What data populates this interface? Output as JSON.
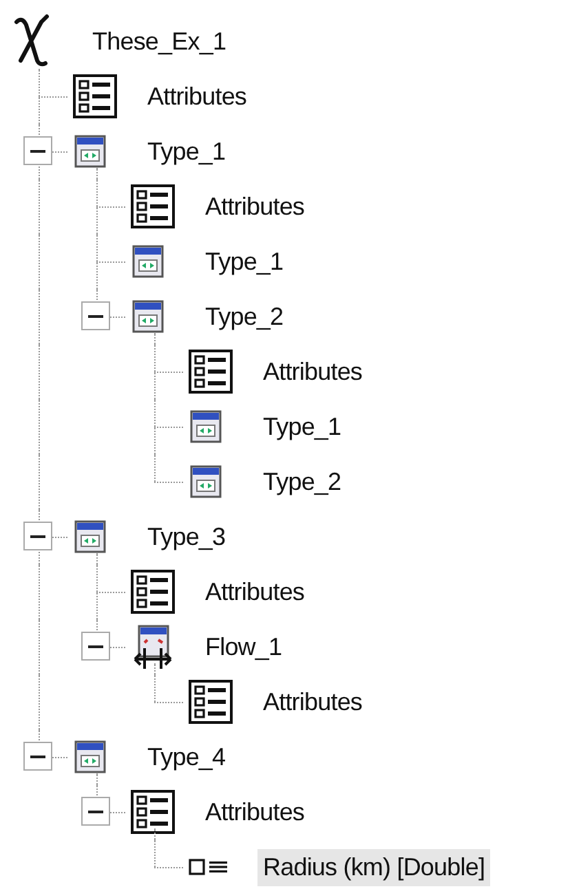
{
  "tree": {
    "label": "These_Ex_1",
    "kind": "root",
    "selected": false,
    "children": [
      {
        "label": "Attributes",
        "kind": "attributes",
        "selected": false
      },
      {
        "label": "Type_1",
        "kind": "type",
        "expanded": true,
        "selected": false,
        "children": [
          {
            "label": "Attributes",
            "kind": "attributes",
            "selected": false
          },
          {
            "label": "Type_1",
            "kind": "type",
            "selected": false
          },
          {
            "label": "Type_2",
            "kind": "type",
            "expanded": true,
            "selected": false,
            "children": [
              {
                "label": "Attributes",
                "kind": "attributes",
                "selected": false
              },
              {
                "label": "Type_1",
                "kind": "type",
                "selected": false
              },
              {
                "label": "Type_2",
                "kind": "type",
                "selected": false
              }
            ]
          }
        ]
      },
      {
        "label": "Type_3",
        "kind": "type",
        "expanded": true,
        "selected": false,
        "children": [
          {
            "label": "Attributes",
            "kind": "attributes",
            "selected": false
          },
          {
            "label": "Flow_1",
            "kind": "flow",
            "expanded": true,
            "selected": false,
            "children": [
              {
                "label": "Attributes",
                "kind": "attributes",
                "selected": false
              }
            ]
          }
        ]
      },
      {
        "label": "Type_4",
        "kind": "type",
        "expanded": true,
        "selected": false,
        "children": [
          {
            "label": "Attributes",
            "kind": "attributes",
            "expanded": true,
            "selected": false,
            "children": [
              {
                "label": "Radius (km) [Double]",
                "kind": "field",
                "selected": true
              }
            ]
          }
        ]
      }
    ]
  }
}
